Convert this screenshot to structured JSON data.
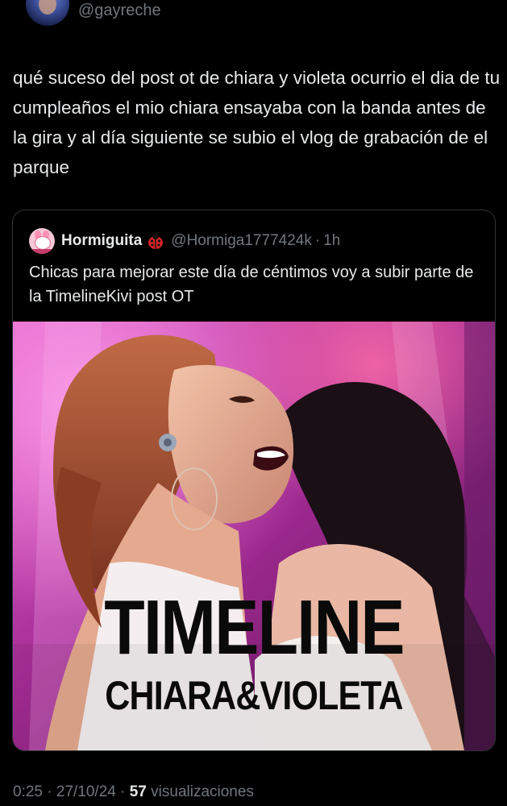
{
  "author": {
    "handle": "@gayreche"
  },
  "tweet": {
    "text": "qué suceso del post ot de chiara y violeta ocurrio el dia de tu cumpleaños el mio chiara ensayaba con la banda antes de la gira y al día siguiente se subio el vlog de grabación de el parque"
  },
  "quote": {
    "name": "Hormiguita",
    "emoji_icon": "ladybug-icon",
    "handle": "@Hormiga1777424k",
    "separator": "·",
    "time": "1h",
    "text": "Chicas para mejorar este día de céntimos voy a subir parte de la TimelineKivi post OT",
    "media": {
      "title": "TIMELINE",
      "subtitle": "CHIARA&VIOLETA"
    }
  },
  "meta": {
    "time": "0:25",
    "sep1": "·",
    "date": "27/10/24",
    "sep2": "·",
    "views_count": "57",
    "views_label": "visualizaciones"
  },
  "colors": {
    "background": "#000000",
    "text_primary": "#e7e9ea",
    "text_secondary": "#71767b",
    "border": "#2f3336",
    "stage_magenta": "#c53fb0"
  }
}
